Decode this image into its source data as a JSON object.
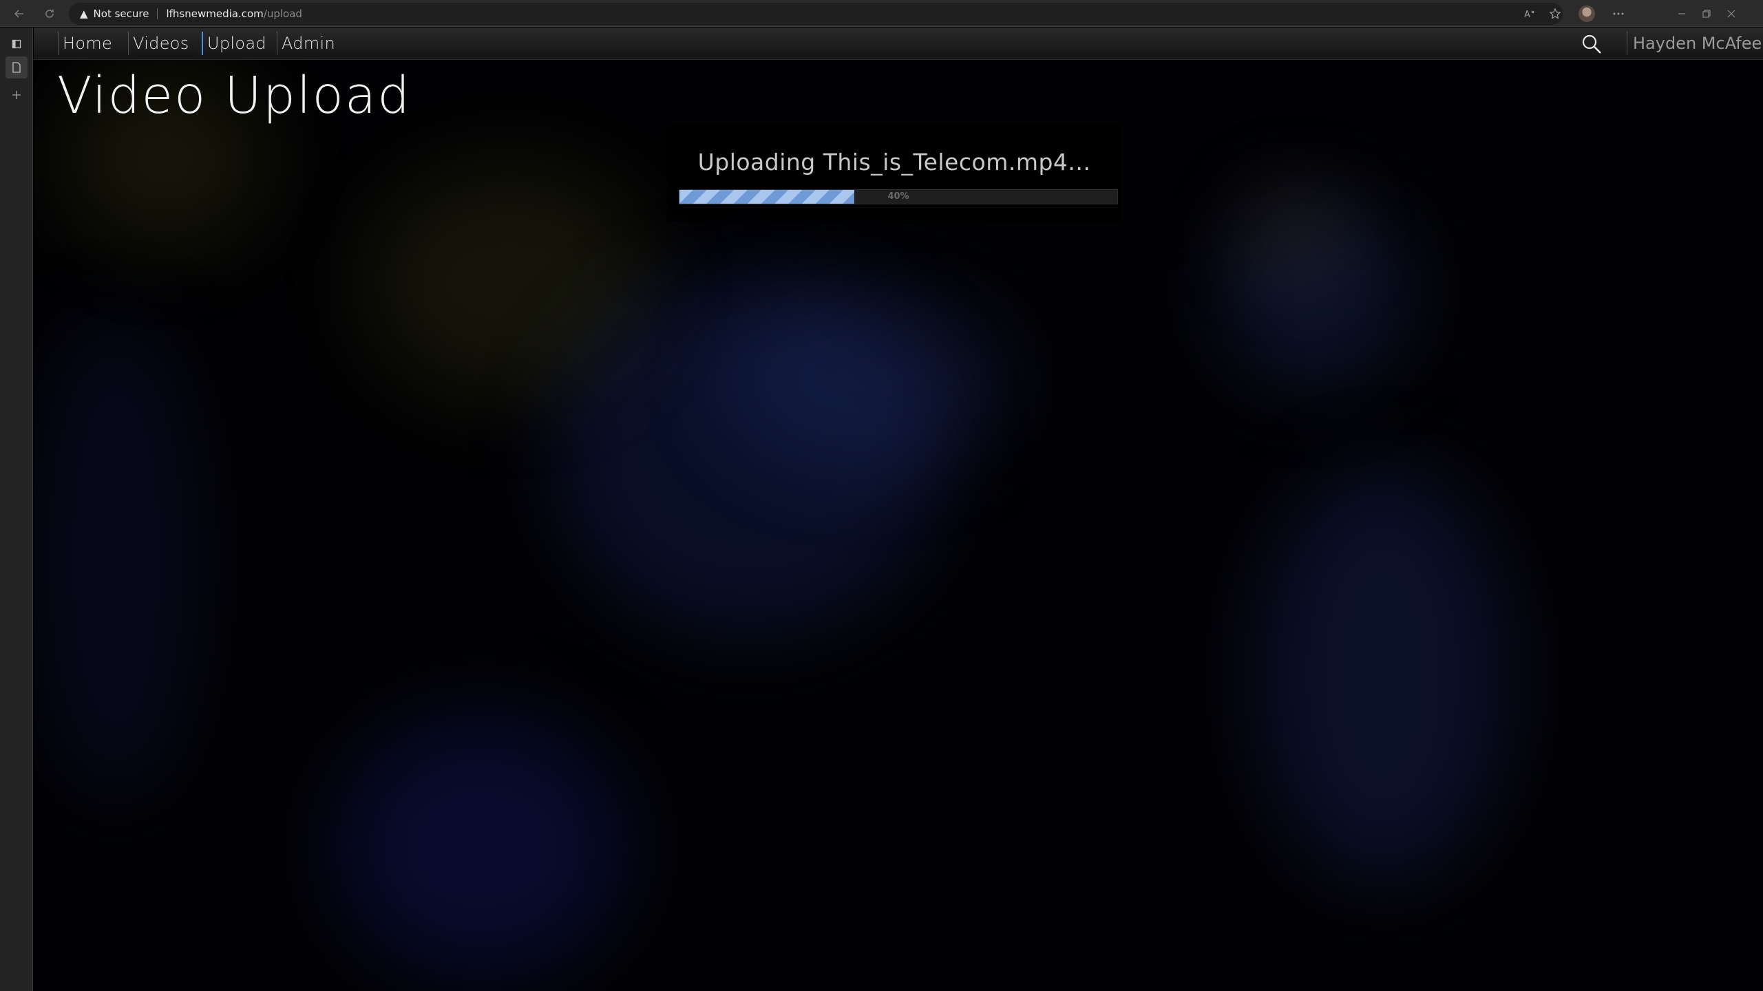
{
  "browser": {
    "security_label": "Not secure",
    "url_host": "lfhsnewmedia.com",
    "url_path": "/upload"
  },
  "nav": {
    "items": [
      {
        "label": "Home"
      },
      {
        "label": "Videos"
      },
      {
        "label": "Upload"
      },
      {
        "label": "Admin"
      }
    ],
    "active": "Upload",
    "user_name": "Hayden McAfee"
  },
  "page": {
    "title": "Video Upload"
  },
  "upload": {
    "status_text": "Uploading This_is_Telecom.mp4...",
    "progress_label": "40%",
    "progress_fraction": 0.4
  },
  "colors": {
    "accent": "#4b8fe0",
    "progress_light": "#a9c6ee",
    "progress_dark": "#6f9ad6"
  }
}
